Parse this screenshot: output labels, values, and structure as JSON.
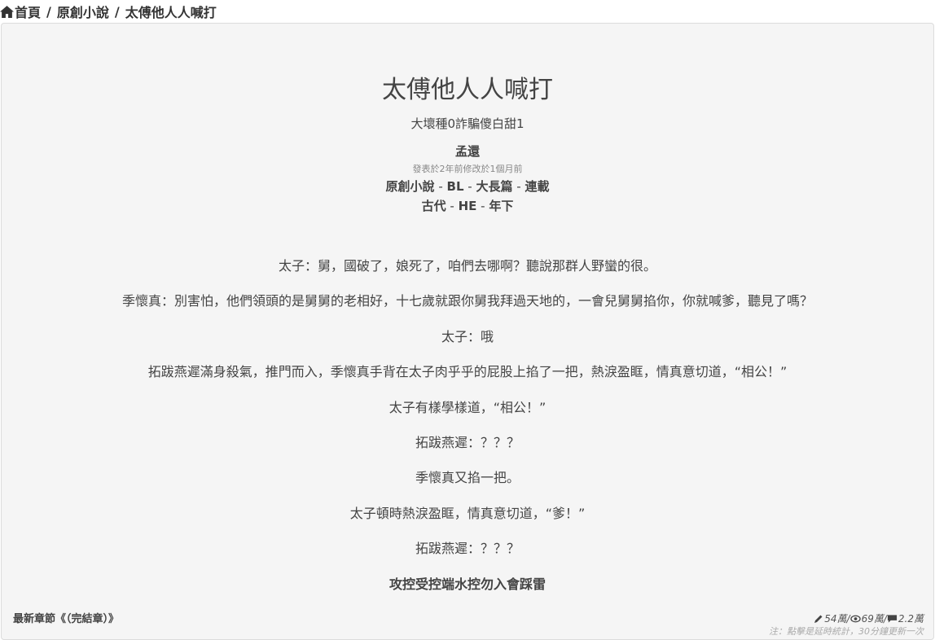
{
  "breadcrumb": {
    "home": "首頁",
    "sep": "/",
    "category": "原創小說",
    "current": "太傅他人人喊打"
  },
  "novel": {
    "title": "太傅他人人喊打",
    "subtitle": "大壞種0詐騙傻白甜1",
    "author": "孟還",
    "dates": "發表於2年前修改於1個月前",
    "tags_row1": [
      "原創小說",
      "BL",
      "大長篇",
      "連載"
    ],
    "tags_row2": [
      "古代",
      "HE",
      "年下"
    ],
    "tag_sep": " - ",
    "summary": [
      "太子：舅，國破了，娘死了，咱們去哪啊？聽說那群人野蠻的很。",
      "季懷真：別害怕，他們領頭的是舅舅的老相好，十七歲就跟你舅我拜過天地的，一會兒舅舅掐你，你就喊爹，聽見了嗎？",
      "太子：哦",
      "拓跋燕遲滿身殺氣，推門而入，季懷真手背在太子肉乎乎的屁股上掐了一把，熱淚盈眶，情真意切道，“相公！”",
      "太子有樣學樣道，“相公！”",
      "拓跋燕遲：？？？",
      "季懷真又掐一把。",
      "太子頓時熱淚盈眶，情真意切道，“爹！”",
      "拓跋燕遲：？？？"
    ],
    "warning": "攻控受控端水控勿入會踩雷"
  },
  "footer": {
    "latest_chapter": "最新章節《（完結章）》",
    "words": "54萬",
    "views": "69萬",
    "comments": "2.2萬",
    "stat_sep": "/",
    "note": "注：點擊是延時統計，30分鐘更新一次"
  },
  "icons": {
    "home": "home-icon",
    "words": "pencil-icon",
    "views": "eye-icon",
    "comments": "comment-icon"
  }
}
